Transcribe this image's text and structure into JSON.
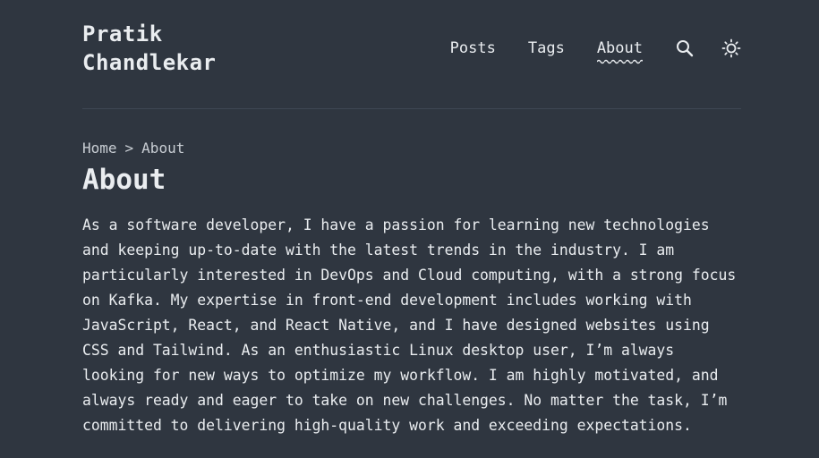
{
  "header": {
    "logo_line1": "Pratik",
    "logo_line2": "Chandlekar",
    "nav": [
      {
        "label": "Posts",
        "active": false
      },
      {
        "label": "Tags",
        "active": false
      },
      {
        "label": "About",
        "active": true
      }
    ],
    "search_icon": "search-icon",
    "theme_icon": "sun-icon"
  },
  "breadcrumb": {
    "home": "Home",
    "separator": ">",
    "current": "About"
  },
  "main": {
    "title": "About",
    "body": "As a software developer, I have a passion for learning new technologies and keeping up-to-date with the latest trends in the industry. I am particularly interested in DevOps and Cloud computing, with a strong focus on Kafka. My expertise in front-end development includes working with JavaScript, React, and React Native, and I have designed websites using CSS and Tailwind. As an enthusiastic Linux desktop user, I’m always looking for new ways to optimize my workflow. I am highly motivated, and always ready and eager to take on new challenges. No matter the task, I’m committed to delivering high-quality work and exceeding expectations."
  },
  "colors": {
    "background": "#2f3640",
    "text": "#eaedf0",
    "muted": "#c9ced4",
    "divider": "#3e4753"
  }
}
